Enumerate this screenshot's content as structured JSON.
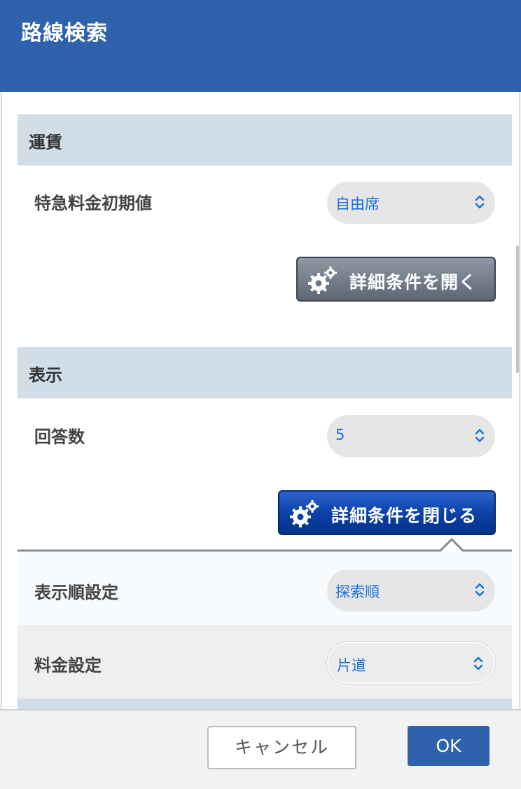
{
  "header": {
    "title": "路線検索"
  },
  "sections": {
    "fare": {
      "title": "運賃",
      "express_label": "特急料金初期値",
      "express_value": "自由席",
      "detail_open_label": "詳細条件を開く"
    },
    "display": {
      "title": "表示",
      "answer_count_label": "回答数",
      "answer_count_value": "5",
      "detail_close_label": "詳細条件を閉じる"
    },
    "details": {
      "order_label": "表示順設定",
      "order_value": "探索順",
      "fee_label": "料金設定",
      "fee_value": "片道"
    }
  },
  "footer": {
    "cancel_label": "キャンセル",
    "ok_label": "OK"
  },
  "colors": {
    "titlebar": "#2f62ad",
    "section_header": "#d1dee8",
    "select_text": "#1a6fd8",
    "open_button": "#6f7884",
    "close_button": "#0a3fa4",
    "ok_button": "#2f62ad"
  },
  "icons": {
    "detail_button": "gears-icon",
    "select_arrow": "chevron-up-down-icon"
  }
}
